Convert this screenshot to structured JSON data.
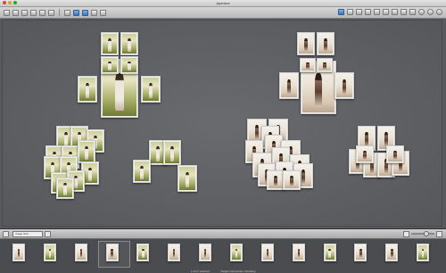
{
  "window": {
    "title": "Aperture"
  },
  "toolbar": {
    "left_icons": [
      "import-icon",
      "new-icon",
      "email-icon",
      "web-icon",
      "book-icon",
      "print-icon",
      "view-toggle-icon",
      "browser-icon",
      "viewer-icon",
      "split-icon",
      "compare-icon"
    ],
    "right_icons": [
      "select-icon",
      "lift-icon",
      "stamp-icon",
      "crop-icon",
      "straighten-icon",
      "redeye-icon",
      "spot-icon",
      "retouch-icon",
      "loupe-icon",
      "hud-icon",
      "inspector-icon",
      "info-icon"
    ]
  },
  "lower_panel": {
    "size_field_value": "Image Size"
  },
  "status": {
    "left_text": "1 of 27 selected",
    "right_text": "Dwight Campuzano Wedding"
  },
  "colors": {
    "canvas_bg": "#5a5c60",
    "photo_border": "#f2f0ea"
  },
  "stacks": {
    "top_left": {
      "photos": 7,
      "tone": "green"
    },
    "top_right": {
      "photos": 7,
      "tone": "white"
    },
    "mid_left": {
      "photos": 12,
      "tone": "green"
    },
    "mid_center": {
      "photos": 4,
      "tone": "green"
    },
    "mid_right": {
      "photos": 14,
      "tone": "white"
    },
    "far_right": {
      "photos": 8,
      "tone": "white"
    }
  },
  "filmstrip": {
    "count": 14,
    "selected_index": 3
  }
}
